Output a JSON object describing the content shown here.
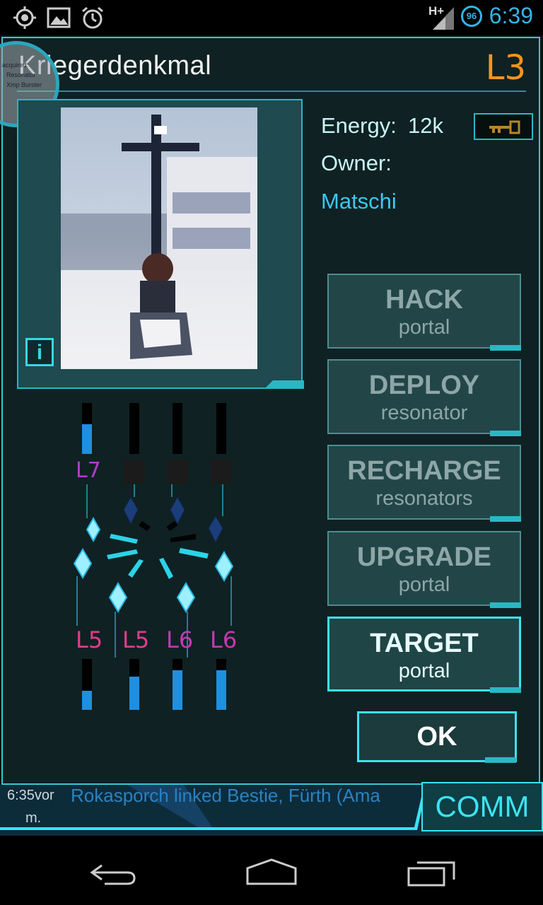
{
  "status_bar": {
    "time": "6:39",
    "battery_level": "96",
    "network": "H+",
    "icons": [
      "gps-icon",
      "image-icon",
      "alarm-icon"
    ]
  },
  "overlay_ring": {
    "lines": [
      "acquired:",
      "Resonator",
      "Xmp Burster"
    ]
  },
  "portal": {
    "title": "Kriegerdenkmal",
    "level": "L3",
    "energy_label": "Energy:",
    "energy_value": "12k",
    "owner_label": "Owner:",
    "owner_name": "Matschi",
    "info_label": "i"
  },
  "actions": [
    {
      "main": "HACK",
      "sub": "portal",
      "active": false
    },
    {
      "main": "DEPLOY",
      "sub": "resonator",
      "active": false
    },
    {
      "main": "RECHARGE",
      "sub": "resonators",
      "active": false
    },
    {
      "main": "UPGRADE",
      "sub": "portal",
      "active": false
    },
    {
      "main": "TARGET",
      "sub": "portal",
      "active": true
    }
  ],
  "ok_label": "OK",
  "resonators_top": [
    {
      "label": "L7",
      "color": "#b43cc8",
      "fill": 0.58
    },
    {
      "label": "",
      "color": "",
      "fill": 0
    },
    {
      "label": "",
      "color": "",
      "fill": 0
    },
    {
      "label": "",
      "color": "",
      "fill": 0
    }
  ],
  "resonators_bottom": [
    {
      "label": "L5",
      "color": "#e23c8c",
      "fill": 0.38
    },
    {
      "label": "L5",
      "color": "#e23c8c",
      "fill": 0.65
    },
    {
      "label": "L6",
      "color": "#c43ab0",
      "fill": 0.78
    },
    {
      "label": "L6",
      "color": "#c43ab0",
      "fill": 0.78
    }
  ],
  "comm": {
    "label": "COMM",
    "message": "Rokasporch linked Bestie, Fürth (Ama",
    "time_line1": "6:35vor",
    "time_line2": "m."
  },
  "colors": {
    "accent": "#3be3f0",
    "level_orange": "#f7941d",
    "owner_blue": "#3cc8f0"
  }
}
